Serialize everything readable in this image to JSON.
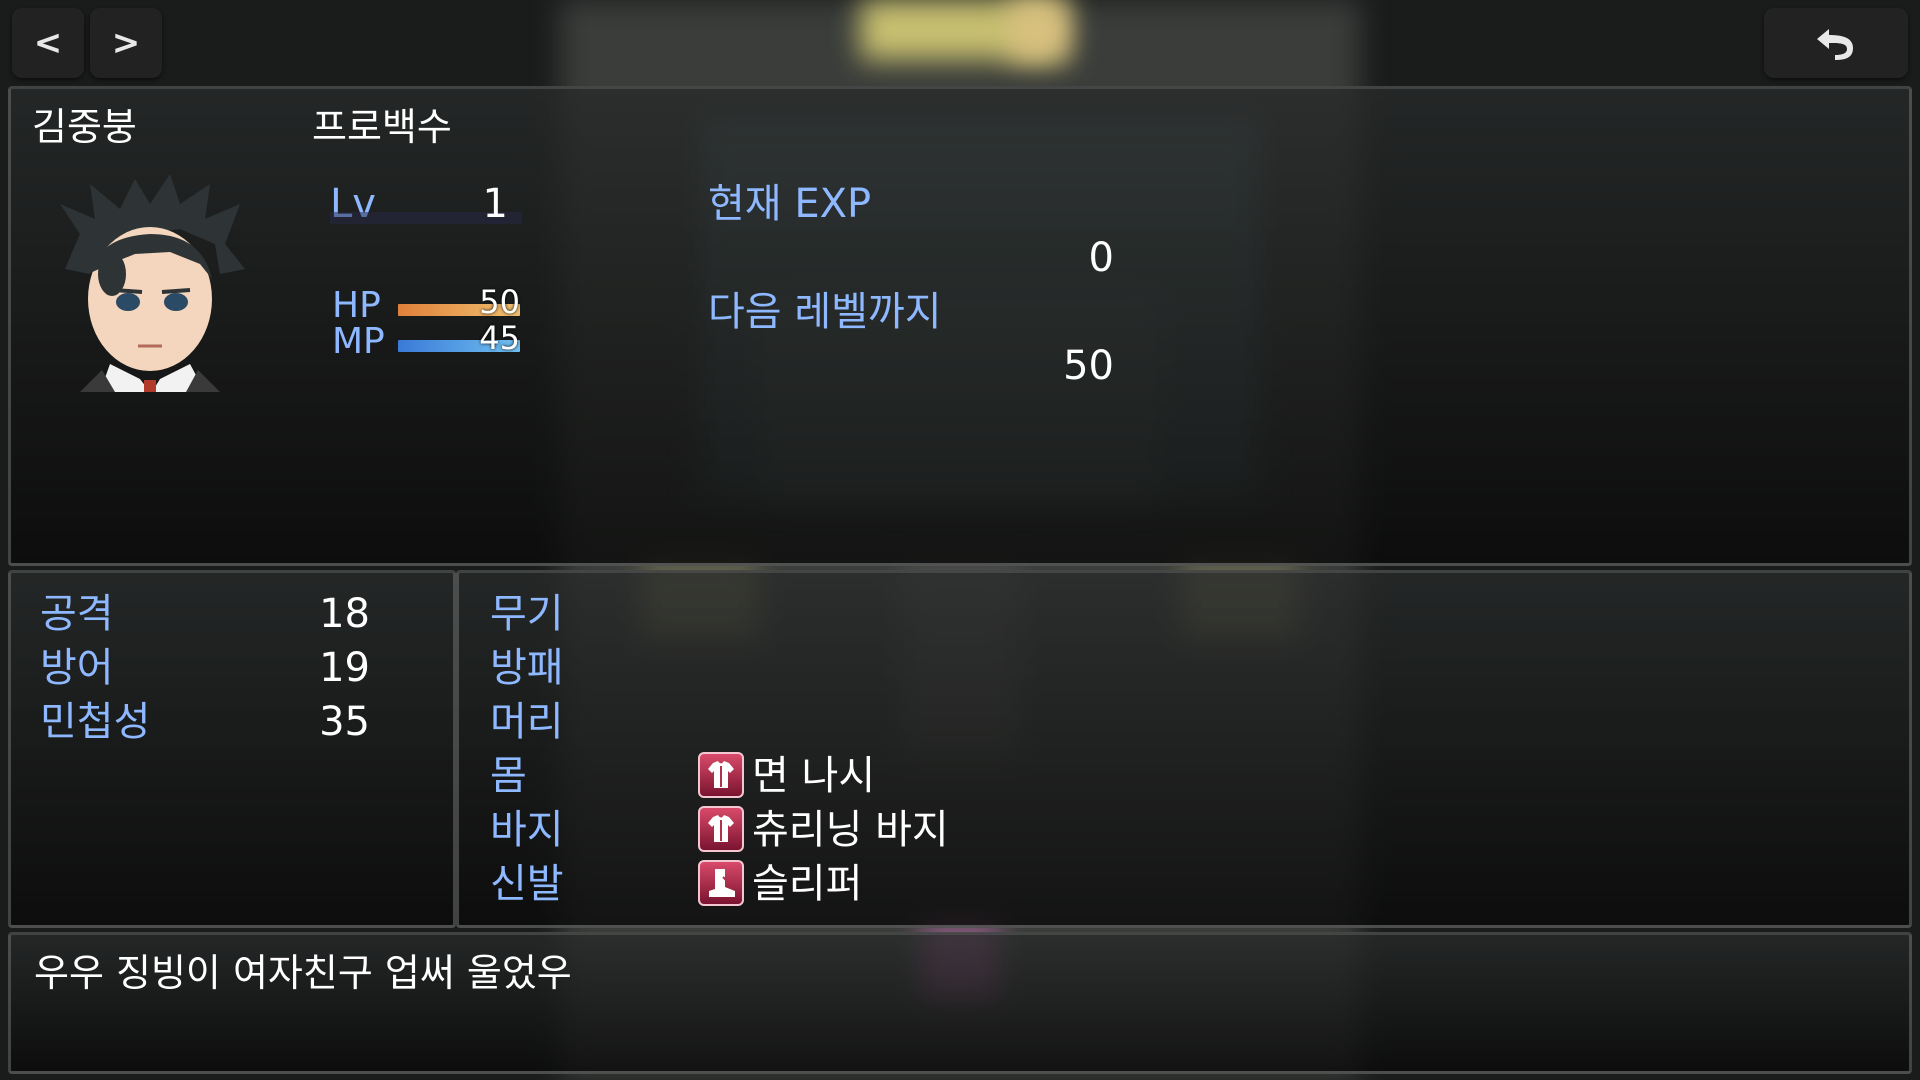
{
  "nav": {
    "prev_label": "<",
    "next_label": ">",
    "back_label": "⮌"
  },
  "actor": {
    "name": "김중붕",
    "class": "프로백수",
    "level_label": "Lv",
    "level": "1",
    "hp_label": "HP",
    "hp": "50",
    "hp_ratio": 1.0,
    "mp_label": "MP",
    "mp": "45",
    "mp_ratio": 1.0
  },
  "exp": {
    "current_label": "현재 EXP",
    "current_value": "0",
    "next_label": "다음 레벨까지",
    "next_value": "50"
  },
  "params": [
    {
      "label": "공격",
      "value": "18"
    },
    {
      "label": "방어",
      "value": "19"
    },
    {
      "label": "민첩성",
      "value": "35"
    }
  ],
  "equips": [
    {
      "slot": "무기",
      "item": "",
      "icon": ""
    },
    {
      "slot": "방패",
      "item": "",
      "icon": ""
    },
    {
      "slot": "머리",
      "item": "",
      "icon": ""
    },
    {
      "slot": "몸",
      "item": "면 나시",
      "icon": "clothing-icon"
    },
    {
      "slot": "바지",
      "item": "츄리닝 바지",
      "icon": "clothing-icon"
    },
    {
      "slot": "신발",
      "item": "슬리퍼",
      "icon": "boot-icon"
    }
  ],
  "profile": "우우 징빙이 여자친구 업써 울었우",
  "colors": {
    "system_text": "#8eb8ff",
    "hp_gauge_start": "#e0803a",
    "hp_gauge_end": "#f0c070",
    "mp_gauge_start": "#3a7ad8",
    "mp_gauge_end": "#70c0f0",
    "icon_bg": "#b0304e"
  }
}
